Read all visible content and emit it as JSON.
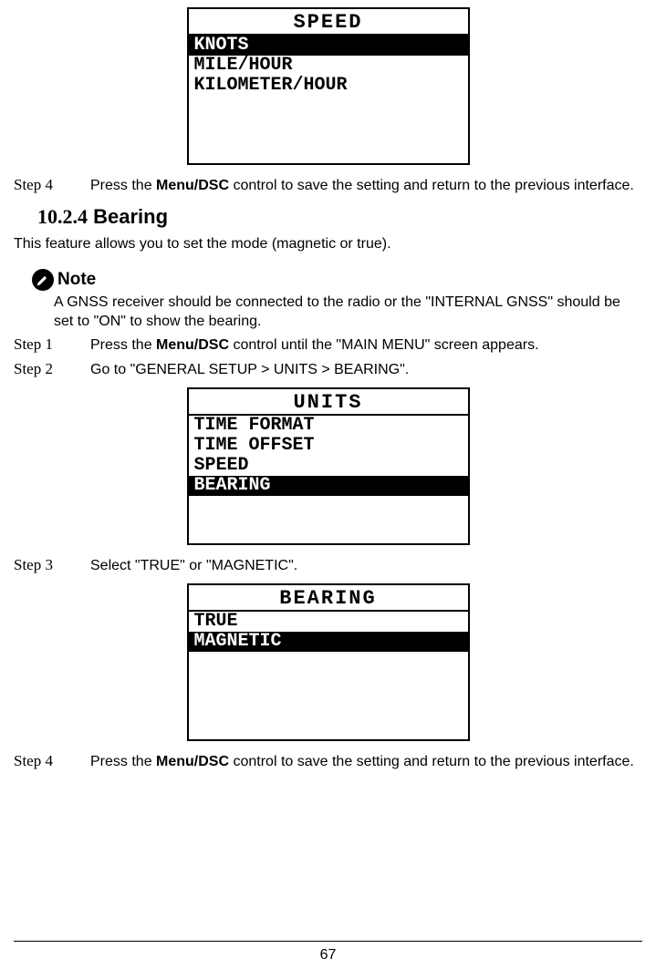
{
  "screen1": {
    "title": "SPEED",
    "items": [
      {
        "label": "KNOTS",
        "selected": true
      },
      {
        "label": "MILE/HOUR",
        "selected": false
      },
      {
        "label": "KILOMETER/HOUR",
        "selected": false
      }
    ]
  },
  "step4a": {
    "label": "Step 4",
    "pre": "Press the ",
    "bold": "Menu/DSC",
    "post": " control to save the setting and return to the previous interface."
  },
  "section": {
    "number": "10.2.4",
    "title": "Bearing"
  },
  "intro": "This feature allows you to set the mode (magnetic or true).",
  "note": {
    "label": "Note",
    "text": "A GNSS receiver should be connected to the radio or the \"INTERNAL GNSS\" should be set to \"ON\" to show the bearing."
  },
  "step1": {
    "label": "Step 1",
    "pre": "Press the ",
    "bold": "Menu/DSC",
    "post": " control until the \"MAIN MENU\" screen appears."
  },
  "step2": {
    "label": "Step 2",
    "text": "Go to \"GENERAL SETUP > UNITS > BEARING\"."
  },
  "screen2": {
    "title": "UNITS",
    "items": [
      {
        "label": "TIME FORMAT",
        "selected": false
      },
      {
        "label": "TIME OFFSET",
        "selected": false
      },
      {
        "label": "SPEED",
        "selected": false
      },
      {
        "label": "BEARING",
        "selected": true
      }
    ]
  },
  "step3": {
    "label": "Step 3",
    "text": "Select \"TRUE\" or \"MAGNETIC\"."
  },
  "screen3": {
    "title": "BEARING",
    "items": [
      {
        "label": "TRUE",
        "selected": false
      },
      {
        "label": "MAGNETIC",
        "selected": true
      }
    ]
  },
  "step4b": {
    "label": "Step 4",
    "pre": "Press the ",
    "bold": "Menu/DSC",
    "post": " control to save the setting and return to the previous interface."
  },
  "pageNumber": "67"
}
